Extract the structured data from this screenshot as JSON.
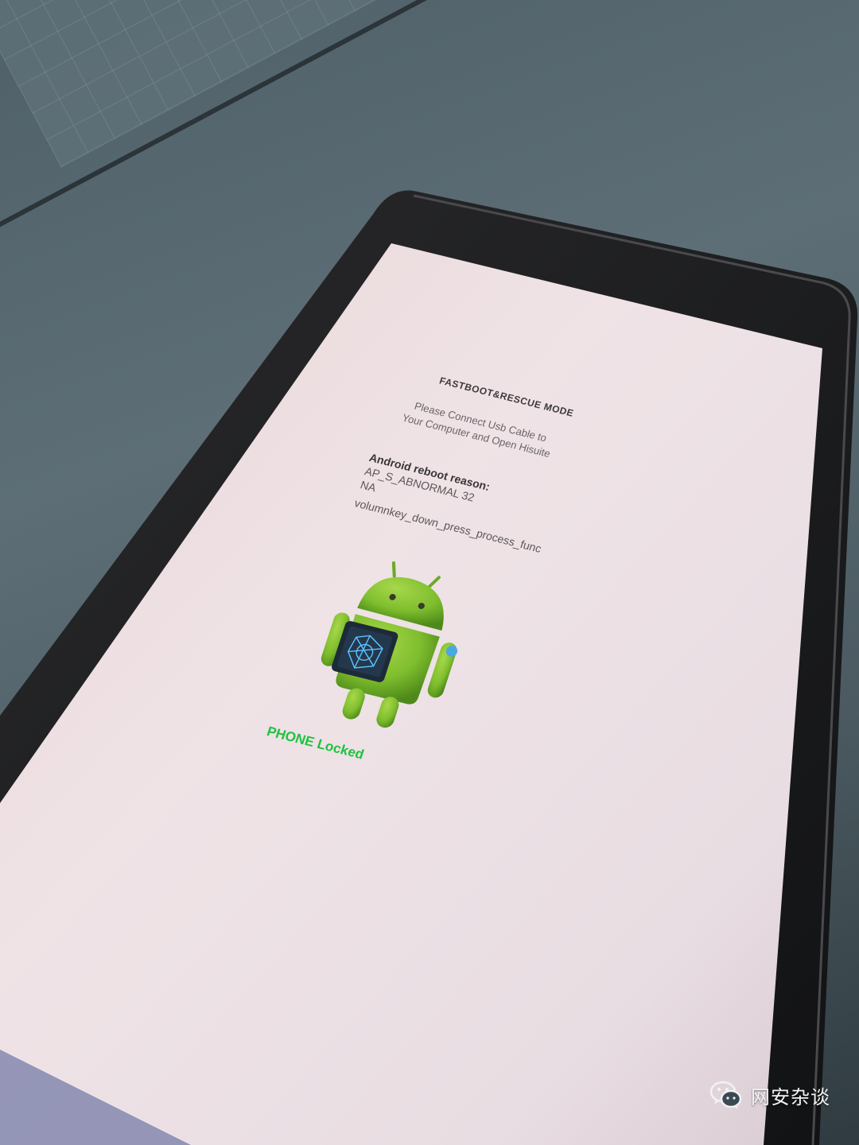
{
  "screen": {
    "title": "FASTBOOT&RESCUE MODE",
    "connect_line_1": "Please Connect Usb Cable to",
    "connect_line_2": "Your Computer and Open Hisuite",
    "reason_label": "Android reboot reason:",
    "reason_line_1": "AP_S_ABNORMAL  32",
    "reason_line_2": "NA",
    "reason_line_3": "volumnkey_down_press_process_func",
    "status": "PHONE Locked"
  },
  "watermark": {
    "text": "网安杂谈"
  },
  "colors": {
    "status_green": "#1fc23e",
    "screen_bg": "#ece1e3",
    "robot_green": "#7fbe2e"
  }
}
